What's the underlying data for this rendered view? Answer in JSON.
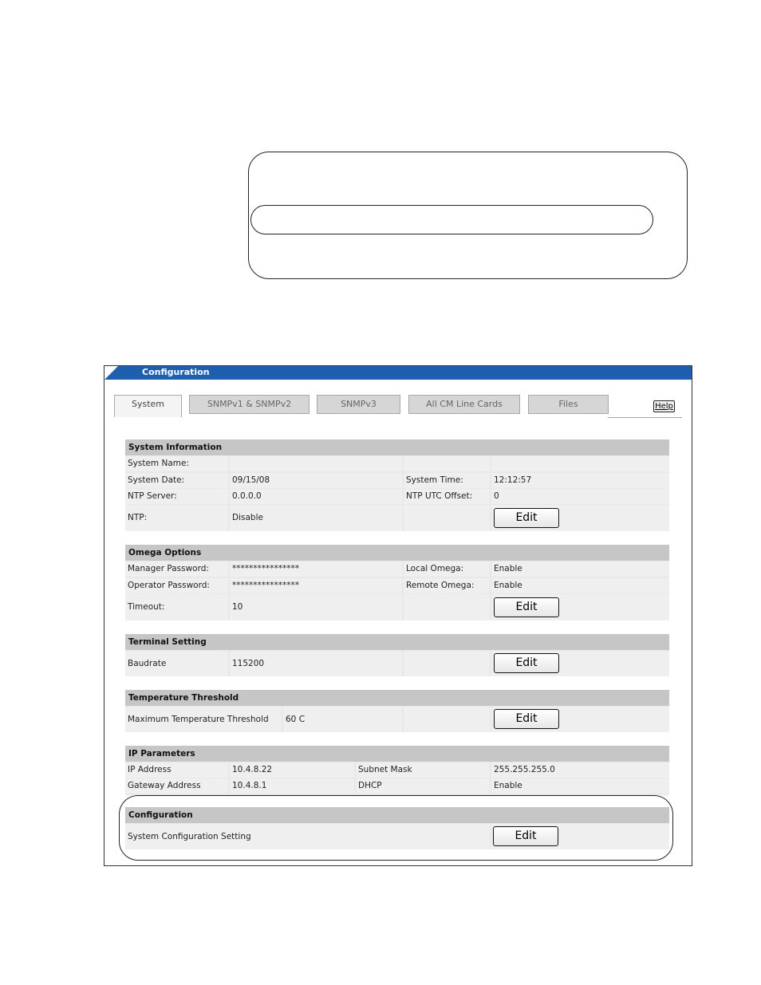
{
  "window": {
    "title": "Configuration"
  },
  "tabs": [
    "System",
    "SNMPv1 & SNMPv2",
    "SNMPv3",
    "All CM Line Cards",
    "Files"
  ],
  "help_label": "Help",
  "edit_label": "Edit",
  "system_information": {
    "heading": "System Information",
    "system_name_label": "System Name:",
    "system_name_value": "",
    "system_date_label": "System Date:",
    "system_date_value": "09/15/08",
    "system_time_label": "System Time:",
    "system_time_value": "12:12:57",
    "ntp_server_label": "NTP Server:",
    "ntp_server_value": "0.0.0.0",
    "ntp_utc_offset_label": "NTP UTC Offset:",
    "ntp_utc_offset_value": "0",
    "ntp_label": "NTP:",
    "ntp_value": "Disable"
  },
  "omega_options": {
    "heading": "Omega Options",
    "manager_password_label": "Manager Password:",
    "manager_password_value": "****************",
    "local_omega_label": "Local Omega:",
    "local_omega_value": "Enable",
    "operator_password_label": "Operator Password:",
    "operator_password_value": "****************",
    "remote_omega_label": "Remote Omega:",
    "remote_omega_value": "Enable",
    "timeout_label": "Timeout:",
    "timeout_value": "10"
  },
  "terminal_setting": {
    "heading": "Terminal Setting",
    "baudrate_label": "Baudrate",
    "baudrate_value": "115200"
  },
  "temperature_threshold": {
    "heading": "Temperature Threshold",
    "max_label": "Maximum Temperature Threshold",
    "max_value": "60 C"
  },
  "ip_parameters": {
    "heading": "IP Parameters",
    "ip_address_label": "IP Address",
    "ip_address_value": "10.4.8.22",
    "subnet_mask_label": "Subnet Mask",
    "subnet_mask_value": "255.255.255.0",
    "gateway_label": "Gateway Address",
    "gateway_value": "10.4.8.1",
    "dhcp_label": "DHCP",
    "dhcp_value": "Enable"
  },
  "configuration": {
    "heading": "Configuration",
    "setting_label": "System Configuration Setting"
  }
}
